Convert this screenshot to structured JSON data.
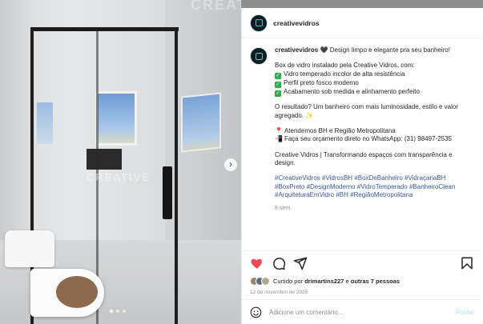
{
  "media": {
    "watermark": "CREATIVE",
    "watermark_top": "CREATIVE",
    "next_icon": "chevron-right-icon",
    "slides": 3,
    "active_slide": 1
  },
  "post": {
    "username": "creativevidros",
    "caption": {
      "intro": "Design limpo e elegante pra seu banheiro!",
      "intro_emoji": "🖤",
      "line1": "Box de vidro instalado pela Creative Vidros, com:",
      "features": [
        "Vidro temperado incolor de alta resistência",
        "Perfil preto fosco moderno",
        "Acabamento sob medida e alinhamento perfeito"
      ],
      "result": "O resultado? Um banheiro com mais luminosidade, estilo e valor agregado. ✨",
      "location": "Atendemos BH e Região Metropolitana",
      "whatsapp": "Faça seu orçamento direto no WhatsApp: (31) 98497-2535",
      "tagline": "Creative Vidros | Transformando espaços com transparência e design.",
      "hashtags": "#CreativeVidros #VidrosBH #BoxDeBanheiro #VidraçariaBH #BoxPreto #DesignModerno #VidroTemperado #BanheiroClean #ArquiteturaEmVidro #BH #RegiãoMetropolitana",
      "time_ago": "8 sem"
    },
    "likes": {
      "prefix": "Curtido por",
      "user": "drimartins227",
      "joiner": "e",
      "others": "outras 7 pessoas"
    },
    "date": "12 de novembro de 2025",
    "comment": {
      "placeholder": "Adicione um comentário...",
      "post_label": "Postar"
    }
  },
  "colors": {
    "like_red": "#ed4956",
    "hashtag_blue": "#385898",
    "post_disabled": "#b2dffc"
  }
}
